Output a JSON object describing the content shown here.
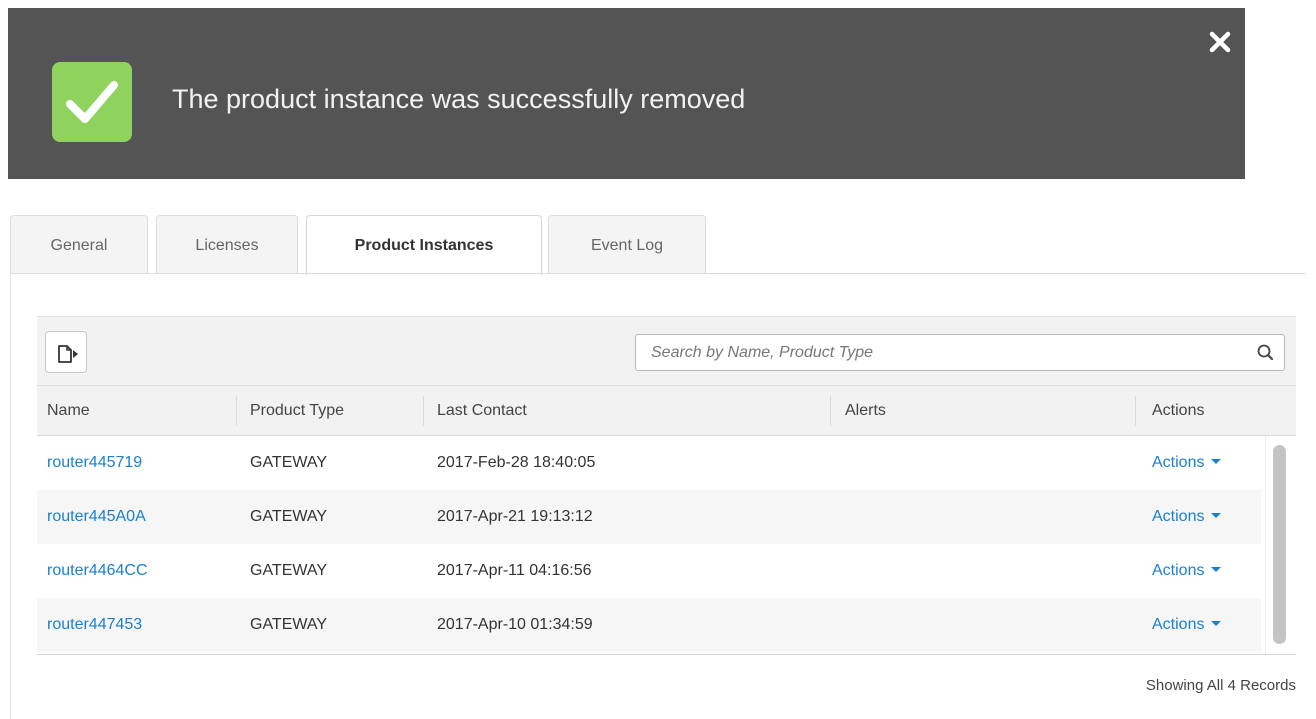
{
  "banner": {
    "message": "The product instance was successfully removed",
    "success_color": "#8fd25e",
    "background_color": "#545454",
    "icon": "checkmark-icon",
    "close_icon": "close-icon"
  },
  "tabs": [
    {
      "label": "General",
      "active": false
    },
    {
      "label": "Licenses",
      "active": false
    },
    {
      "label": "Product Instances",
      "active": true
    },
    {
      "label": "Event Log",
      "active": false
    }
  ],
  "toolbar": {
    "export_icon": "export-icon",
    "search": {
      "placeholder": "Search by Name, Product Type",
      "value": "",
      "icon": "search-icon"
    }
  },
  "table": {
    "columns": [
      "Name",
      "Product Type",
      "Last Contact",
      "Alerts",
      "Actions"
    ],
    "rows": [
      {
        "name": "router445719",
        "product_type": "GATEWAY",
        "last_contact": "2017-Feb-28 18:40:05",
        "alerts": "",
        "actions": "Actions"
      },
      {
        "name": "router445A0A",
        "product_type": "GATEWAY",
        "last_contact": "2017-Apr-21 19:13:12",
        "alerts": "",
        "actions": "Actions"
      },
      {
        "name": "router4464CC",
        "product_type": "GATEWAY",
        "last_contact": "2017-Apr-11 04:16:56",
        "alerts": "",
        "actions": "Actions"
      },
      {
        "name": "router447453",
        "product_type": "GATEWAY",
        "last_contact": "2017-Apr-10 01:34:59",
        "alerts": "",
        "actions": "Actions"
      }
    ],
    "link_color": "#1a7fcf"
  },
  "footer": {
    "record_count": "Showing All 4 Records"
  }
}
